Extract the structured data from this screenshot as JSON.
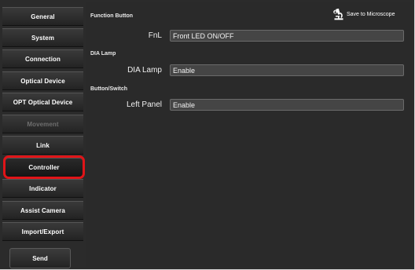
{
  "sidebar": {
    "items": [
      {
        "label": "General",
        "state": "normal"
      },
      {
        "label": "System",
        "state": "normal"
      },
      {
        "label": "Connection",
        "state": "normal"
      },
      {
        "label": "Optical Device",
        "state": "normal"
      },
      {
        "label": "OPT Optical Device",
        "state": "normal"
      },
      {
        "label": "Movement",
        "state": "disabled"
      },
      {
        "label": "Link",
        "state": "normal"
      },
      {
        "label": "Controller",
        "state": "selected"
      },
      {
        "label": "Indicator",
        "state": "normal"
      },
      {
        "label": "Assist Camera",
        "state": "normal"
      },
      {
        "label": "Import/Export",
        "state": "normal"
      }
    ],
    "send_label": "Send"
  },
  "main": {
    "save_label": "Save to Microscope",
    "save_icon": "microscope-icon",
    "sections": [
      {
        "title": "Function Button",
        "row_label": "FnL",
        "value": "Front LED ON/OFF"
      },
      {
        "title": "DIA Lamp",
        "row_label": "DIA Lamp",
        "value": "Enable"
      },
      {
        "title": "Button/Switch",
        "row_label": "Left Panel",
        "value": "Enable"
      }
    ]
  },
  "colors": {
    "background": "#2b2b2b",
    "field": "#454545",
    "selected_outline": "#e01418"
  }
}
